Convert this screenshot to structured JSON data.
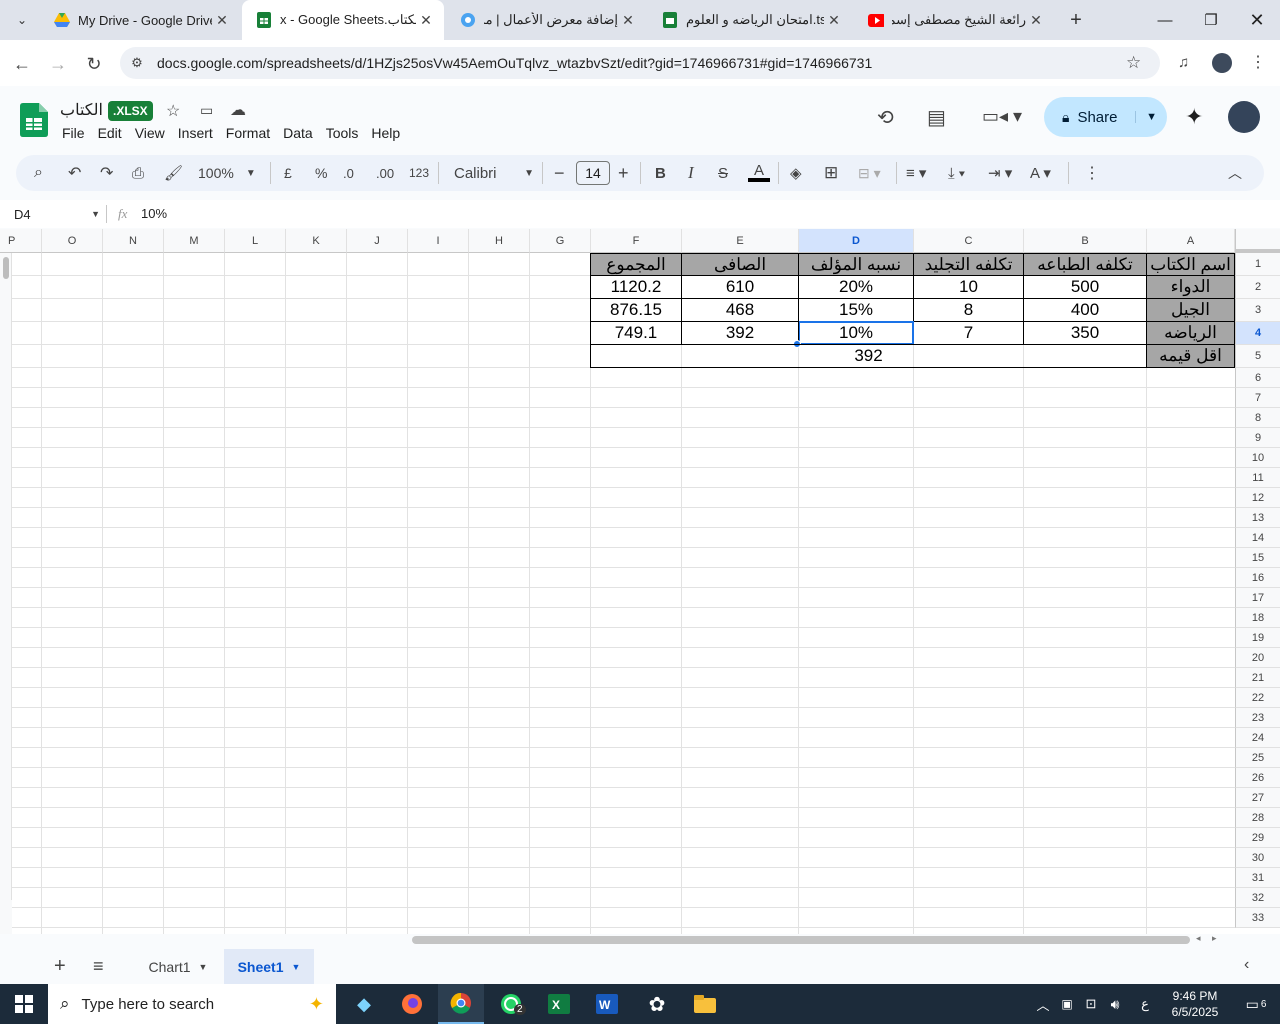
{
  "browser": {
    "tabs": [
      {
        "title": "My Drive - Google Drive",
        "icon": "google-drive-icon"
      },
      {
        "title": "x - Google Sheets.الكتاب",
        "icon": "google-sheets-icon",
        "active": true
      },
      {
        "title": "إضافة معرض الأعمال | مس...",
        "icon": "site-icon"
      },
      {
        "title": "امتحان الرياضه و العلوم.ts",
        "icon": "google-sheets-icon"
      },
      {
        "title": "رائعة الشيخ مصطفى إسما",
        "icon": "youtube-icon"
      }
    ],
    "new_tab": "+",
    "url": "docs.google.com/spreadsheets/d/1HZjs25osVw45AemOuTqlvz_wtazbvSzt/edit?gid=1746966731#gid=1746966731"
  },
  "doc": {
    "title": "الكتاب",
    "badge": ".XLSX",
    "menu": [
      "File",
      "Edit",
      "View",
      "Insert",
      "Format",
      "Data",
      "Tools",
      "Help"
    ],
    "share_label": "Share"
  },
  "toolbar": {
    "zoom": "100%",
    "currency": "£",
    "percent": "%",
    "dec_decrease": ".0",
    "dec_increase": ".00",
    "number_format": "123",
    "font": "Calibri",
    "font_size": "14",
    "bold": "B",
    "italic": "I",
    "text_color": "A"
  },
  "formula_bar": {
    "name_box": "D4",
    "fx": "fx",
    "value": "10%"
  },
  "grid": {
    "col_headers": [
      "A",
      "B",
      "C",
      "D",
      "E",
      "F",
      "G",
      "H",
      "I",
      "J",
      "K",
      "L",
      "M",
      "N",
      "O",
      "P"
    ],
    "row_headers": [
      "1",
      "2",
      "3",
      "4",
      "5",
      "6",
      "7",
      "8",
      "9",
      "10",
      "11",
      "12",
      "13",
      "14",
      "15",
      "16",
      "17",
      "18",
      "19",
      "20",
      "21",
      "22",
      "23",
      "24",
      "25",
      "26",
      "27",
      "28",
      "29",
      "30",
      "31",
      "32",
      "33"
    ],
    "selected_cell": "D4",
    "header_row": [
      "اسم الكتاب",
      "تكلفه الطباعه",
      "تكلفه التجليد",
      "نسبه المؤلف",
      "الصافى",
      "المجموع"
    ],
    "rows": [
      [
        "الدواء",
        "500",
        "10",
        "20%",
        "610",
        "1120.2"
      ],
      [
        "الجيل",
        "400",
        "8",
        "15%",
        "468",
        "876.15"
      ],
      [
        "الرياضه",
        "350",
        "7",
        "10%",
        "392",
        "749.1"
      ]
    ],
    "min_row": {
      "label": "اقل قيمه",
      "value": "392"
    }
  },
  "sheets": {
    "add": "+",
    "tabs": [
      "Chart1",
      "Sheet1"
    ],
    "active": "Sheet1"
  },
  "taskbar": {
    "search_placeholder": "Type here to search",
    "whatsapp_badge": "2",
    "lang": "ع",
    "time": "9:46 PM",
    "date": "6/5/2025",
    "notif_count": "6"
  },
  "colors": {
    "sheets_green": "#188038",
    "selection_blue": "#1a73e8",
    "header_fill": "#a6a6a6",
    "share_bg": "#c2e7ff"
  }
}
